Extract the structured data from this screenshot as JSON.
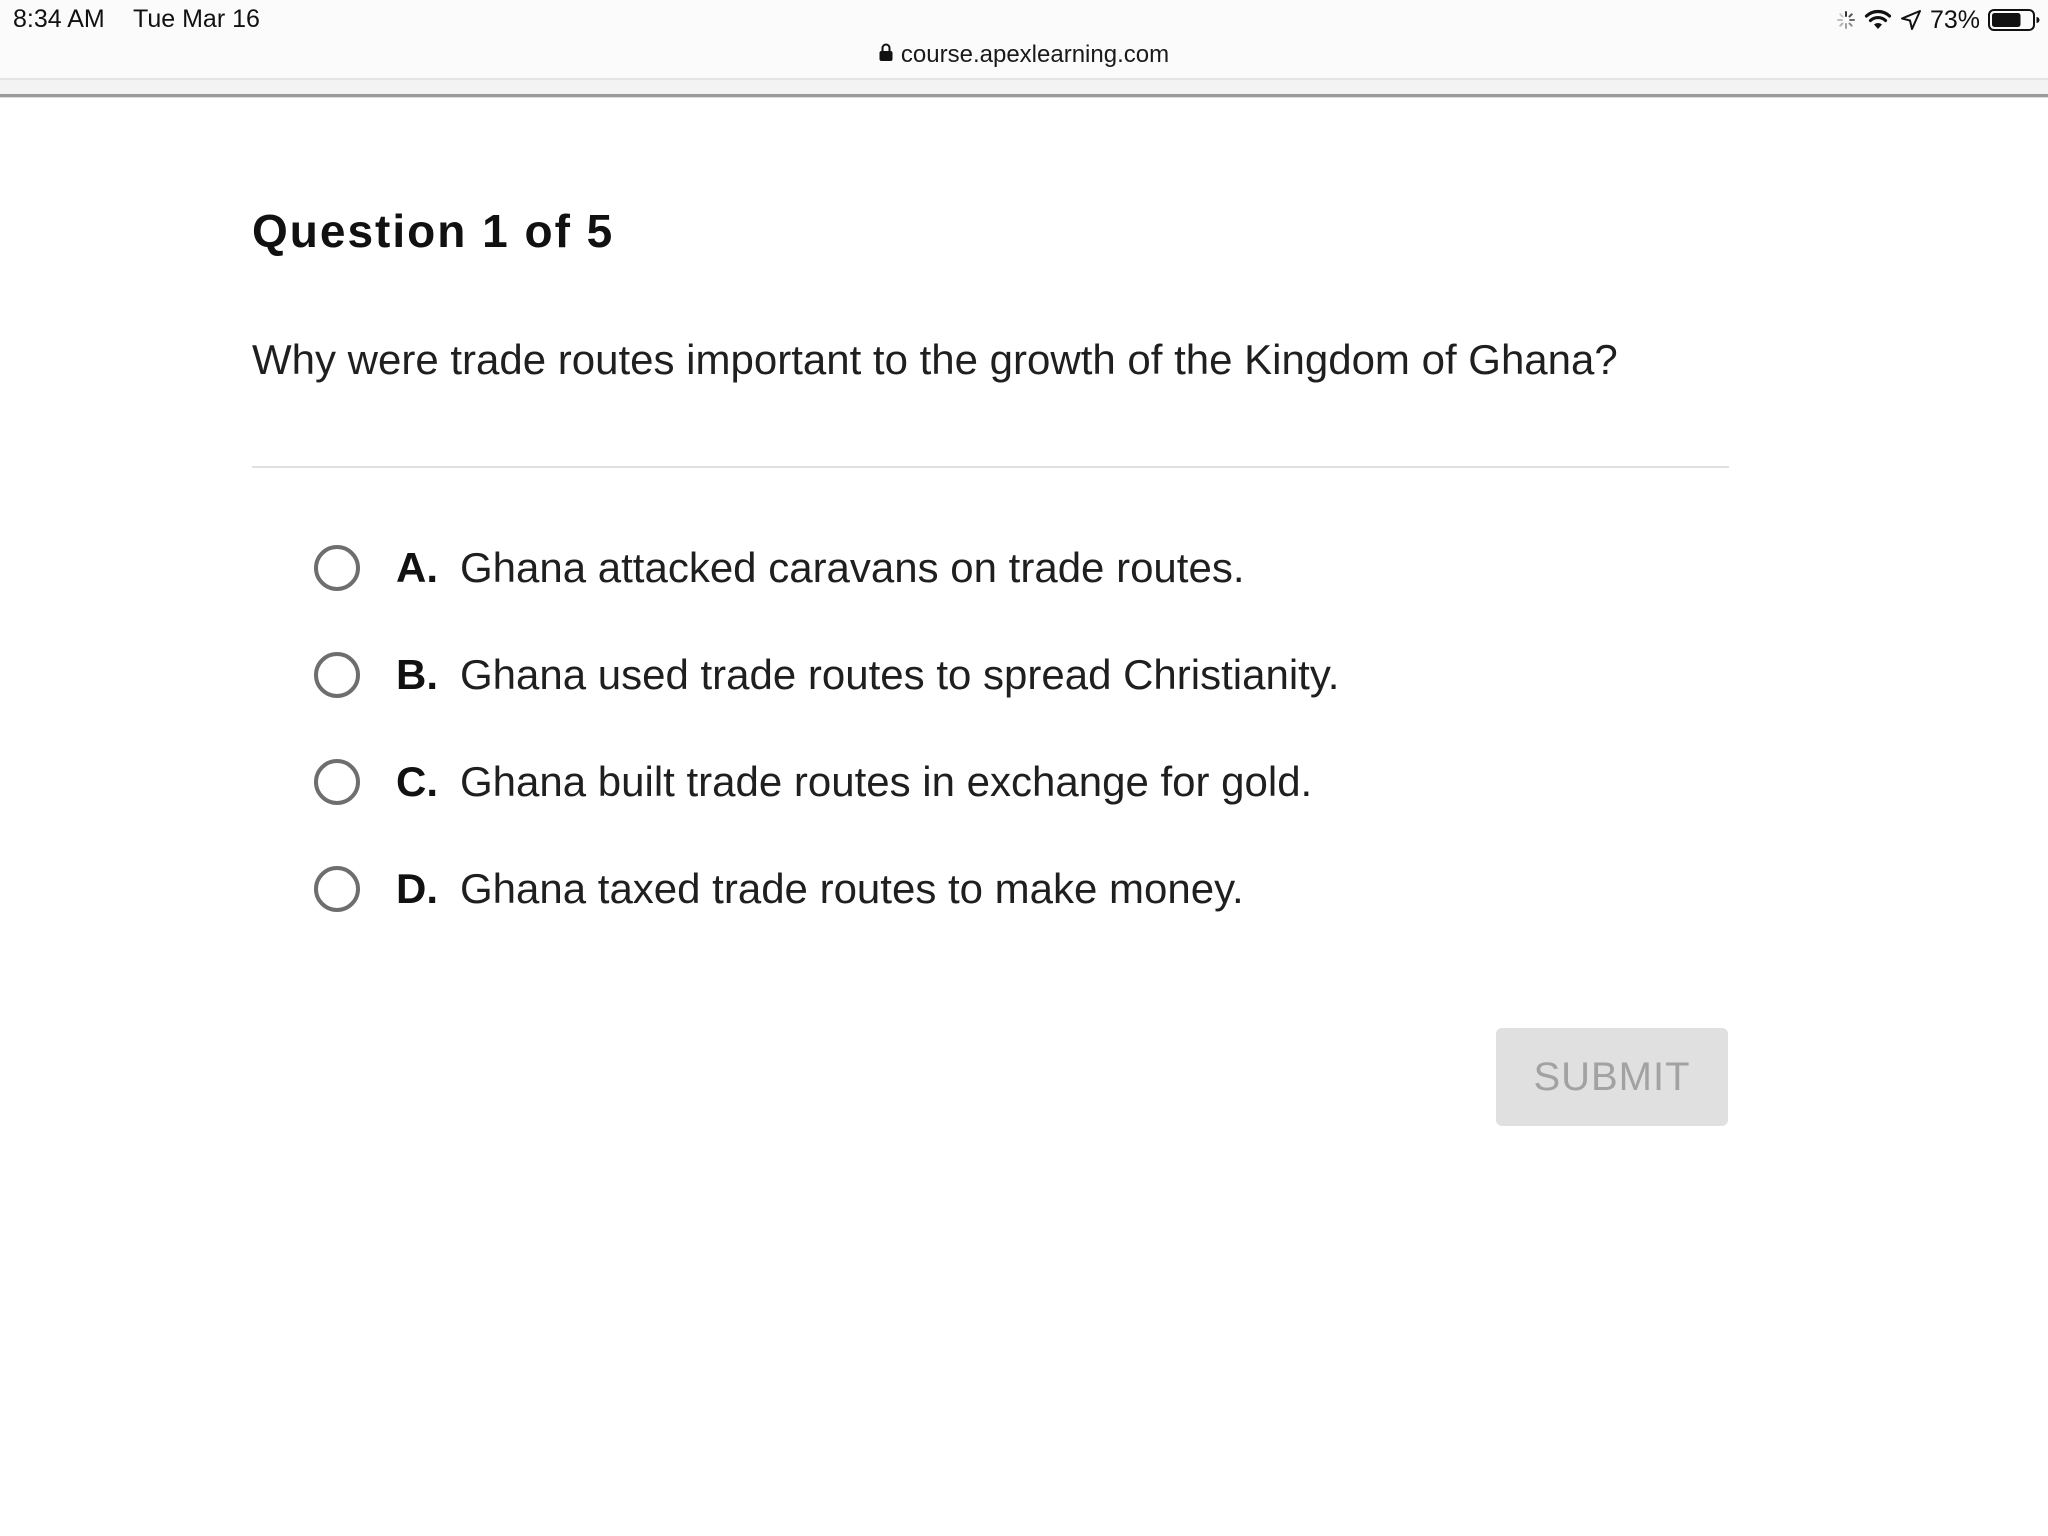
{
  "status_bar": {
    "time": "8:34 AM",
    "date": "Tue Mar 16",
    "battery_percent": "73%",
    "battery_level": 0.73,
    "icons": [
      "loading-spinner-icon",
      "wifi-icon",
      "location-arrow-icon",
      "battery-icon"
    ]
  },
  "browser": {
    "url": "course.apexlearning.com",
    "url_icon": "lock-icon"
  },
  "quiz": {
    "header": "Question 1 of 5",
    "question": "Why were trade routes important to the growth of the Kingdom of Ghana?",
    "options": [
      {
        "letter": "A.",
        "text": "Ghana attacked caravans on trade routes.",
        "selected": false
      },
      {
        "letter": "B.",
        "text": "Ghana used trade routes to spread Christianity.",
        "selected": false
      },
      {
        "letter": "C.",
        "text": "Ghana built trade routes in exchange for gold.",
        "selected": false
      },
      {
        "letter": "D.",
        "text": "Ghana taxed trade routes to make money.",
        "selected": false
      }
    ],
    "submit_label": "SUBMIT",
    "submit_enabled": false
  },
  "colors": {
    "radio_border": "#6e6e6e",
    "submit_bg": "#e0e0e0",
    "submit_text": "#a2a2a2",
    "divider": "#e0e0e0"
  }
}
